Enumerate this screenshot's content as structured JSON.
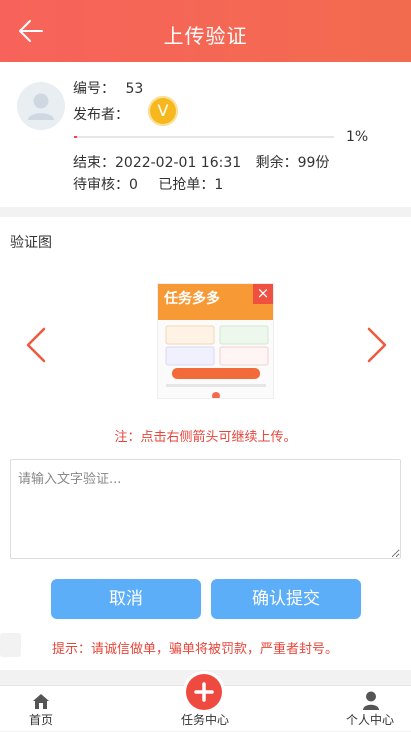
{
  "header": {
    "title": "上传验证",
    "back_icon": "arrow-left-icon"
  },
  "task": {
    "number_label": "编号：",
    "number": "53",
    "publisher_label": "发布者：",
    "publisher_badge": "V",
    "progress": 0.01,
    "progress_text": "1%",
    "end_label": "结束：",
    "end_time": "2022-02-01 16:31",
    "remaining_label": "剩余：",
    "remaining": "99份",
    "pending_label": "待审核：",
    "pending": "0",
    "taken_label": "已抢单：",
    "taken": "1"
  },
  "verify": {
    "section_label": "验证图",
    "note": "注：点击右侧箭头可继续上传。",
    "text_placeholder": "请输入文字验证...",
    "cancel_label": "取消",
    "submit_label": "确认提交",
    "tip": "提示：请诚信做单，骗单将被罚款，严重者封号。",
    "thumb_banner": "任务多多"
  },
  "tabbar": {
    "home": "首页",
    "tasks": "任务中心",
    "profile": "个人中心"
  },
  "colors": {
    "accent": "#f26b4f",
    "button": "#5caef9",
    "warning": "#e8463b"
  }
}
